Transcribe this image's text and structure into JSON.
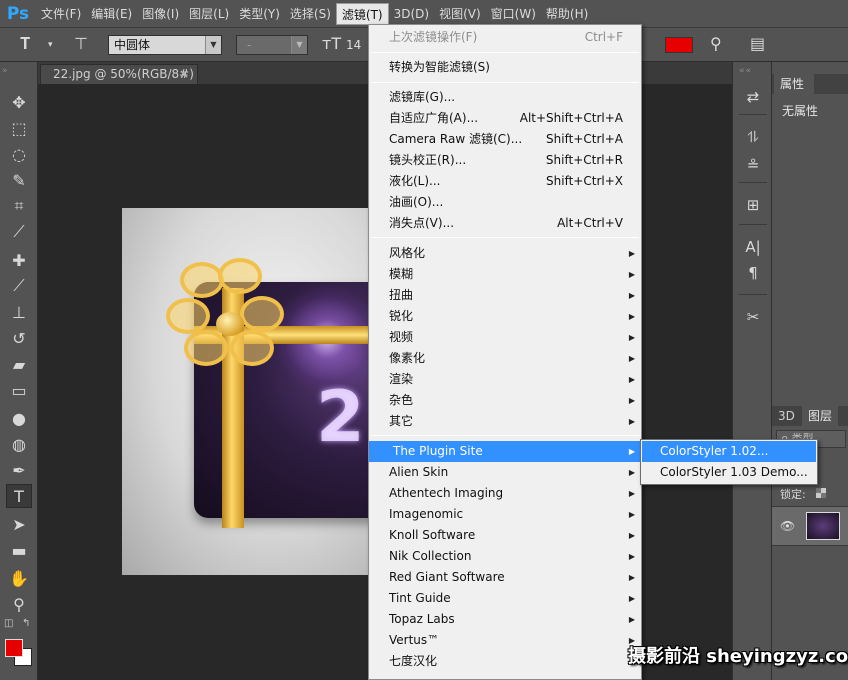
{
  "app": {
    "logo": "Ps"
  },
  "menubar": {
    "items": [
      "文件(F)",
      "编辑(E)",
      "图像(I)",
      "图层(L)",
      "类型(Y)",
      "选择(S)",
      "滤镜(T)",
      "3D(D)",
      "视图(V)",
      "窗口(W)",
      "帮助(H)"
    ],
    "active_index": 6
  },
  "options_bar": {
    "font_family": "中圆体",
    "font_style": "-",
    "font_size": "14",
    "text_color": "#e60000"
  },
  "document_tab": {
    "title": "22.jpg @ 50%(RGB/8#)",
    "close_glyph": "×"
  },
  "filter_menu": {
    "last_filter": {
      "label": "上次滤镜操作(F)",
      "shortcut": "Ctrl+F"
    },
    "convert_smart": "转换为智能滤镜(S)",
    "group1": [
      {
        "label": "滤镜库(G)...",
        "shortcut": ""
      },
      {
        "label": "自适应广角(A)...",
        "shortcut": "Alt+Shift+Ctrl+A"
      },
      {
        "label": "Camera Raw 滤镜(C)...",
        "shortcut": "Shift+Ctrl+A"
      },
      {
        "label": "镜头校正(R)...",
        "shortcut": "Shift+Ctrl+R"
      },
      {
        "label": "液化(L)...",
        "shortcut": "Shift+Ctrl+X"
      },
      {
        "label": "油画(O)...",
        "shortcut": ""
      },
      {
        "label": "消失点(V)...",
        "shortcut": "Alt+Ctrl+V"
      }
    ],
    "group2": [
      "风格化",
      "模糊",
      "扭曲",
      "锐化",
      "视频",
      "像素化",
      "渲染",
      "杂色",
      "其它"
    ],
    "group3": [
      "The Plugin Site",
      "Alien Skin",
      "Athentech Imaging",
      "Imagenomic",
      "Knoll Software",
      "Nik Collection",
      "Red Giant Software",
      "Tint Guide",
      "Topaz Labs",
      "Vertus™",
      "七度汉化"
    ],
    "highlighted": "The Plugin Site"
  },
  "submenu": {
    "items": [
      "ColorStyler 1.02...",
      "ColorStyler 1.03 Demo..."
    ],
    "highlighted_index": 0
  },
  "properties_panel": {
    "tab_label": "属性",
    "empty_text": "无属性"
  },
  "layers_panel": {
    "tabs": [
      "3D",
      "图层"
    ],
    "filter_label": "ρ 类型",
    "lock_label": "锁定:",
    "visibility_glyph": "👁"
  },
  "canvas": {
    "overlay_digit": "2"
  },
  "watermark": "摄影前沿 sheyingzyz.com",
  "icons": {
    "text-tool-icon": "T",
    "move-tool-icon": "move",
    "marquee-tool-icon": "rect-select",
    "lasso-tool-icon": "lasso",
    "quick-select-icon": "brush-select",
    "crop-tool-icon": "crop",
    "eyedropper-icon": "eyedropper",
    "healing-icon": "bandage",
    "brush-icon": "brush",
    "stamp-icon": "stamp",
    "history-brush-icon": "history-brush",
    "eraser-icon": "eraser",
    "gradient-icon": "gradient",
    "blur-icon": "drop",
    "dodge-icon": "dodge",
    "pen-icon": "pen",
    "path-select-icon": "arrow",
    "shape-icon": "rect",
    "hand-icon": "hand",
    "zoom-icon": "magnifier"
  },
  "colors": {
    "accent_highlight": "#3390ff",
    "foreground": "#e60000",
    "background": "#ffffff"
  }
}
